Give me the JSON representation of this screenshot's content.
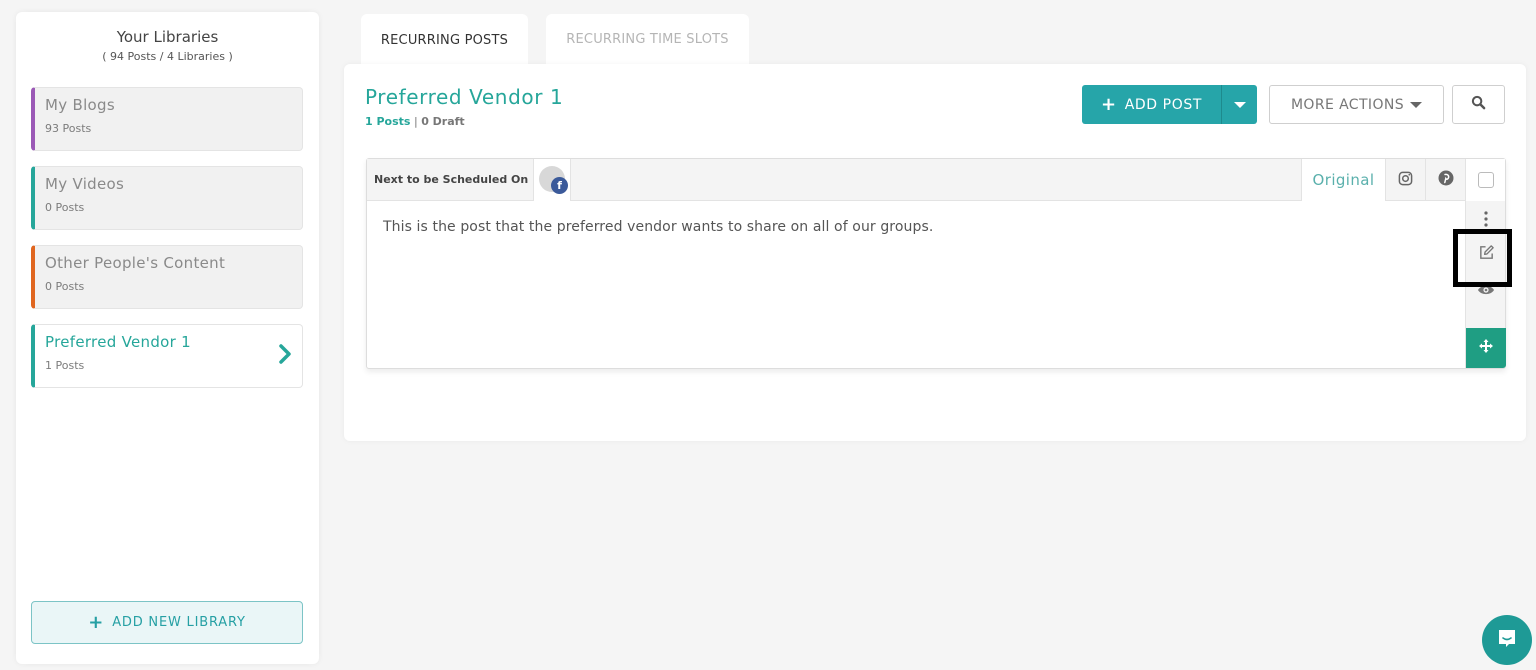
{
  "sidebar": {
    "title": "Your Libraries",
    "summary": "( 94 Posts / 4 Libraries )",
    "libraries": [
      {
        "name": "My Blogs",
        "count": "93 Posts",
        "color": "#9b59b6",
        "active": false
      },
      {
        "name": "My Videos",
        "count": "0 Posts",
        "color": "#26a69a",
        "active": false
      },
      {
        "name": "Other People's Content",
        "count": "0 Posts",
        "color": "#e0661f",
        "active": false
      },
      {
        "name": "Preferred Vendor 1",
        "count": "1 Posts",
        "color": "#26a69a",
        "active": true
      }
    ],
    "active_chevron_icon": "chevron-right-icon",
    "add_library_label": "ADD NEW LIBRARY"
  },
  "tabs": [
    {
      "label": "RECURRING POSTS",
      "active": true
    },
    {
      "label": "RECURRING TIME SLOTS",
      "active": false
    }
  ],
  "library": {
    "title": "Preferred Vendor 1",
    "posts_stat": "1 Posts",
    "separator": "|",
    "drafts_stat": "0 Draft"
  },
  "toolbar": {
    "add_post_label": "ADD POST",
    "more_actions_label": "MORE ACTIONS",
    "search_icon": "search-icon"
  },
  "post": {
    "schedule_label": "Next to be Scheduled On",
    "schedule_network": "facebook",
    "variant_tabs": [
      {
        "label": "Original",
        "active": true
      },
      {
        "icon": "instagram-icon"
      },
      {
        "icon": "pinterest-icon"
      }
    ],
    "body": "This is the post that the preferred vendor wants to share on all of our groups.",
    "actions": [
      "more-vertical-icon",
      "edit-icon",
      "eye-icon",
      "move-icon"
    ]
  },
  "colors": {
    "accent": "#26a69a",
    "button": "#26a5a9",
    "move_button": "#1f9e83",
    "facebook": "#3b5a9a"
  }
}
